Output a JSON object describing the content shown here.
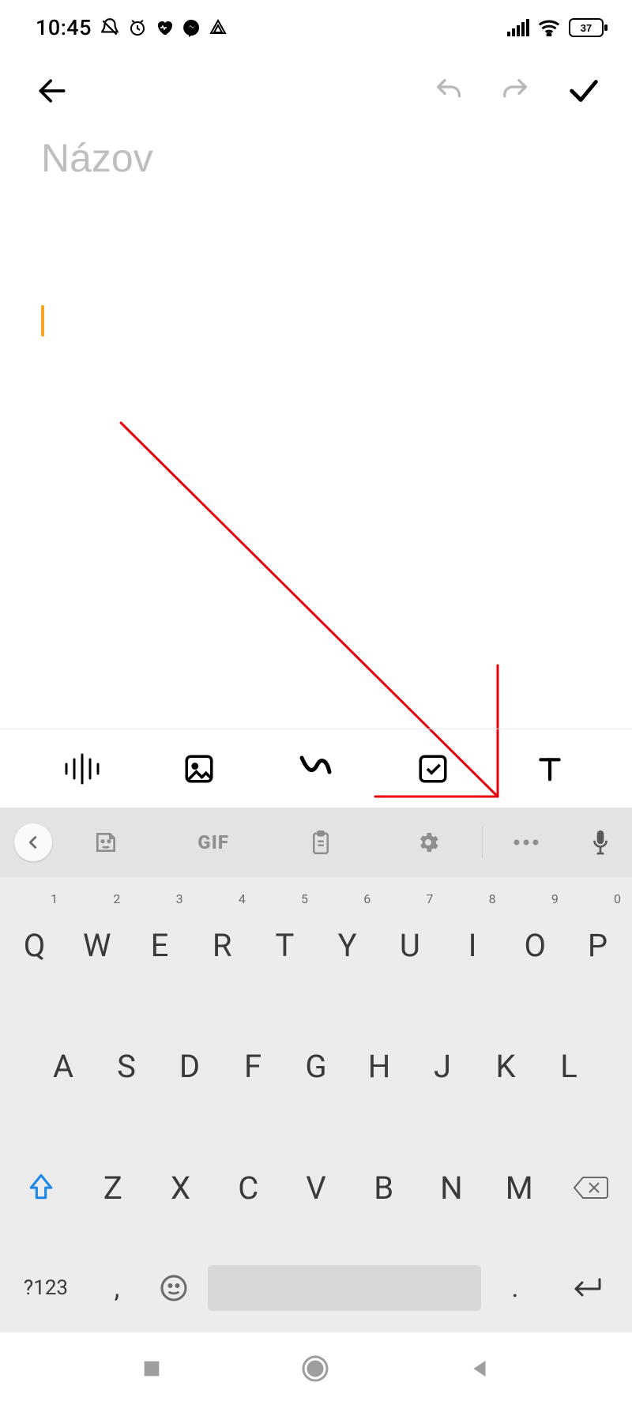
{
  "status": {
    "time": "10:45",
    "battery_pct": "37"
  },
  "toolbar": {
    "back_label": "back",
    "undo_label": "undo",
    "redo_label": "redo",
    "done_label": "done"
  },
  "note": {
    "title_placeholder": "Názov",
    "title_value": "",
    "body_value": ""
  },
  "note_tools": {
    "audio": "audio",
    "image": "image",
    "draw": "draw",
    "checklist": "checklist",
    "text": "text-format"
  },
  "keyboard": {
    "top": {
      "sticker": "sticker",
      "gif": "GIF",
      "clipboard": "clipboard",
      "settings": "settings",
      "more": "more",
      "mic": "mic"
    },
    "row1": [
      {
        "k": "Q",
        "s": "1"
      },
      {
        "k": "W",
        "s": "2"
      },
      {
        "k": "E",
        "s": "3"
      },
      {
        "k": "R",
        "s": "4"
      },
      {
        "k": "T",
        "s": "5"
      },
      {
        "k": "Y",
        "s": "6"
      },
      {
        "k": "U",
        "s": "7"
      },
      {
        "k": "I",
        "s": "8"
      },
      {
        "k": "O",
        "s": "9"
      },
      {
        "k": "P",
        "s": "0"
      }
    ],
    "row2": [
      "A",
      "S",
      "D",
      "F",
      "G",
      "H",
      "J",
      "K",
      "L"
    ],
    "row3": [
      "Z",
      "X",
      "C",
      "V",
      "B",
      "N",
      "M"
    ],
    "mode_key": "?123",
    "comma": ",",
    "dot": "."
  },
  "annotation": {
    "color": "#E3000F"
  }
}
